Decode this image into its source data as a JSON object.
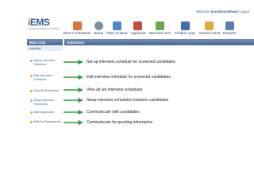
{
  "header": {
    "welcome_label": "Welcome",
    "welcome_user": "(sunilvasudevan)",
    "logout": "Logout",
    "logo_text": "iEMS",
    "logo_sub": "Education Management Solutions"
  },
  "nav": [
    {
      "label": "Direct Admission",
      "icon": "user-add-icon",
      "color": "#d9743a"
    },
    {
      "label": "Setup",
      "icon": "gear-icon",
      "color": "#7d8ea3"
    },
    {
      "label": "Filter Criteria",
      "icon": "filter-icon",
      "color": "#4b89c9"
    },
    {
      "label": "Applicant",
      "icon": "applicant-icon",
      "color": "#c74b3a"
    },
    {
      "label": "Interview Sch.",
      "icon": "calendar-icon",
      "color": "#6aa84f"
    },
    {
      "label": "Finalize App.",
      "icon": "checklist-icon",
      "color": "#3d6eb4"
    },
    {
      "label": "Instant Admit",
      "icon": "admit-icon",
      "color": "#e0a83a"
    },
    {
      "label": "Reports",
      "icon": "chart-icon",
      "color": "#5a7fb0"
    }
  ],
  "sidebar": {
    "title": "Main Link",
    "subtitle": "Interview",
    "items": [
      {
        "label": "Setup Interview Schedule"
      },
      {
        "label": "Edit Interview Schedule"
      },
      {
        "label": "View All Schedules"
      },
      {
        "label": "Swap Interview Schedules"
      },
      {
        "label": "Mail Applicants"
      },
      {
        "label": "Mail for Pending Info"
      }
    ]
  },
  "main": {
    "title": "Admission"
  },
  "descriptions": [
    "Set up interview schedule for screened candidates",
    "Edit interview schedule for screened candidates",
    "View all set interview schedules",
    "Swap interview schedules between candidates",
    "Communicate with candidates",
    "Communicate for pending information"
  ],
  "colors": {
    "arrow": "#2e9e3e",
    "bar": "#48699a",
    "bullet": "#f2a23a"
  }
}
